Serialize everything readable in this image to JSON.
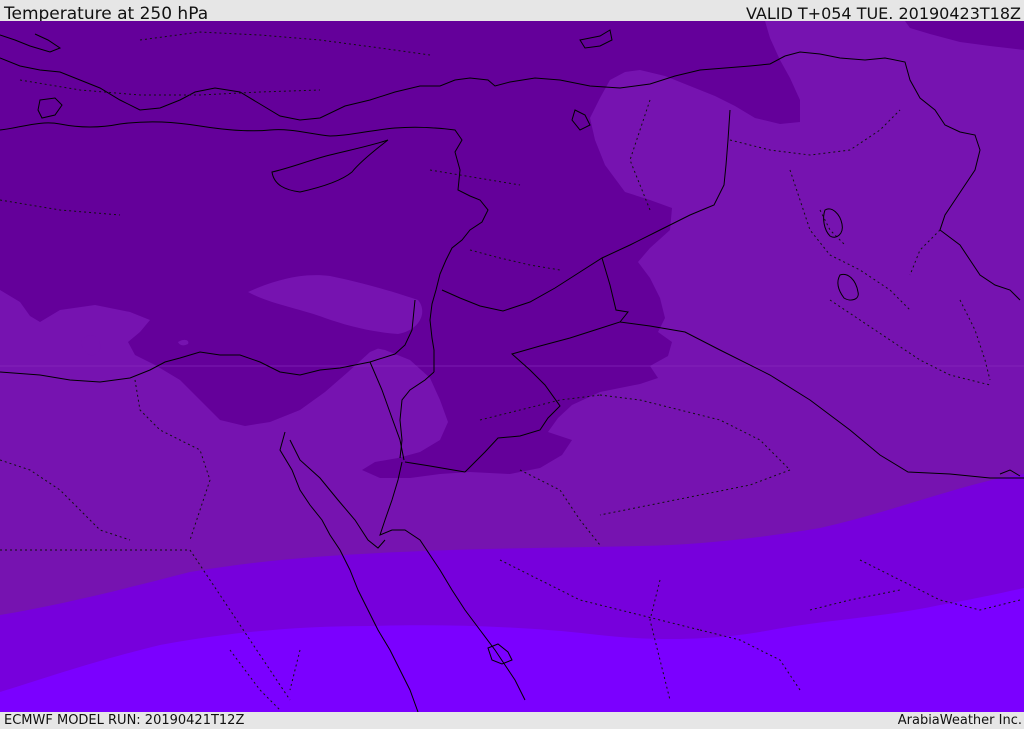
{
  "header": {
    "title": "Temperature at 250 hPa",
    "valid": "VALID T+054 TUE. 20190423T18Z"
  },
  "footer": {
    "model_run": "ECMWF MODEL RUN: 20190421T12Z",
    "brand": "ArabiaWeather Inc."
  },
  "map": {
    "colors": {
      "coldest": "#64009a",
      "cold": "#7613b0",
      "mid": "#7700dc",
      "warm": "#7b00ff",
      "border": "#000000"
    }
  }
}
